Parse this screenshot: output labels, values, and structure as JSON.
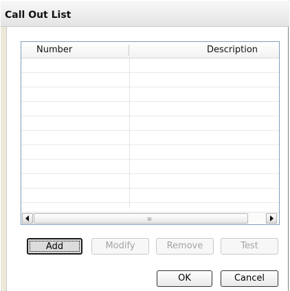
{
  "window": {
    "title": "Call Out List"
  },
  "list": {
    "columns": [
      "Number",
      "Description"
    ],
    "rows": [
      "",
      "",
      "",
      "",
      "",
      "",
      "",
      "",
      "",
      ""
    ]
  },
  "scrollbar": {
    "left_icon": "chevron-left-icon",
    "right_icon": "chevron-right-icon",
    "grip_icon": "grip-icon"
  },
  "actions": {
    "add": "Add",
    "modify": "Modify",
    "remove": "Remove",
    "test": "Test"
  },
  "dialog_buttons": {
    "ok": "OK",
    "cancel": "Cancel"
  }
}
